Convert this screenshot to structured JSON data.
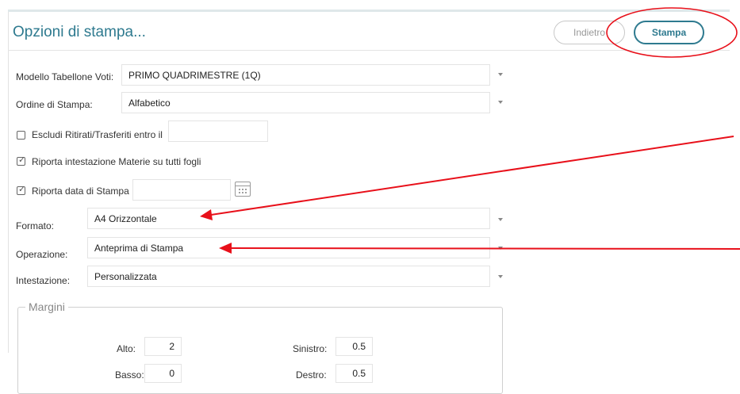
{
  "header": {
    "title": "Opzioni di stampa...",
    "back_label": "Indietro",
    "print_label": "Stampa"
  },
  "form": {
    "modello_label": "Modello Tabellone Voti:",
    "modello_value": "PRIMO QUADRIMESTRE (1Q)",
    "ordine_label": "Ordine di Stampa:",
    "ordine_value": "Alfabetico",
    "escludi_label": "Escludi Ritirati/Trasferiti entro il",
    "escludi_checked": false,
    "riporta_intestazione_label": "Riporta intestazione Materie su tutti fogli",
    "riporta_intestazione_checked": true,
    "riporta_data_label": "Riporta data di Stampa",
    "riporta_data_checked": true,
    "formato_label": "Formato:",
    "formato_value": "A4 Orizzontale",
    "operazione_label": "Operazione:",
    "operazione_value": "Anteprima di Stampa",
    "intestazione_label": "Intestazione:",
    "intestazione_value": "Personalizzata"
  },
  "margini": {
    "legend": "Margini",
    "alto_label": "Alto:",
    "alto_value": "2",
    "basso_label": "Basso:",
    "basso_value": "0",
    "sinistro_label": "Sinistro:",
    "sinistro_value": "0.5",
    "destro_label": "Destro:",
    "destro_value": "0.5"
  },
  "colors": {
    "accent": "#2e7a8f",
    "annotation": "#e8101a"
  }
}
